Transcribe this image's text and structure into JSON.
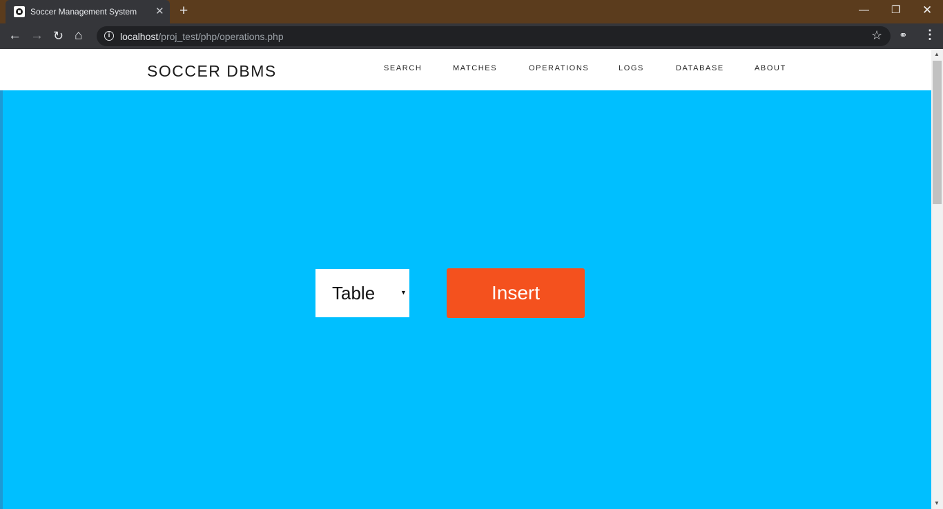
{
  "browser": {
    "tab_title": "Soccer Management System",
    "tab_close": "✕",
    "new_tab": "+",
    "url_host": "localhost",
    "url_path": "/proj_test/php/operations.php",
    "icons": {
      "back": "←",
      "forward": "→",
      "reload": "↻",
      "home": "⌂",
      "info": "i",
      "star": "☆",
      "extension": "⚭",
      "menu": "⋮",
      "minimize": "—",
      "maximize": "❐",
      "close": "✕"
    }
  },
  "navbar": {
    "brand": "SOCCER DBMS",
    "links": [
      "SEARCH",
      "MATCHES",
      "OPERATIONS",
      "LOGS",
      "DATABASE",
      "ABOUT"
    ]
  },
  "operations": {
    "table_select": "Table",
    "select_arrow": "▼",
    "insert_label": "Insert"
  },
  "scrollbar": {
    "up": "▲",
    "down": "▼"
  },
  "colors": {
    "titlebar": "#5b3c1d",
    "page_background": "#00bfff",
    "insert_button": "#f4511e"
  }
}
